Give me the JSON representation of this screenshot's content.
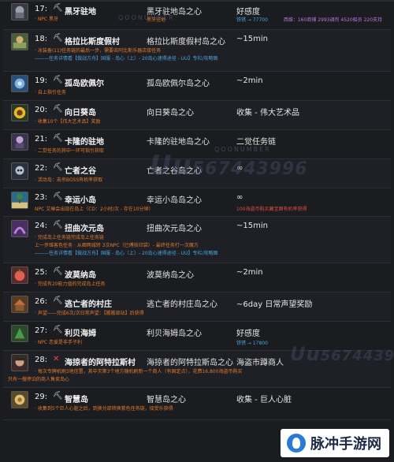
{
  "rows": [
    {
      "num": "17:",
      "title": "黑牙驻地",
      "location": "黑牙驻地岛之心",
      "reward": "好感度",
      "subs": [
        {
          "text": "· NPC 黑牙",
          "color": "orange"
        }
      ],
      "loc_extra": "黑牙驻地",
      "fav_values": {
        "blue": "铁锈 → 77700",
        "purple": "西维：160商铺 2993调剂 4520船员 220支持"
      }
    },
    {
      "num": "18:",
      "title": "格拉比斯度假村",
      "location": "格拉比斯度假村岛之心",
      "reward": "~15min",
      "subs": [
        {
          "text": "· 冰装备(11)任务链的最后一步，需要去阿比斯乐器店接任务",
          "color": "orange"
        },
        {
          "text": "———任务详情看【做战方舟】国服 - 岛心（上）- 20岛心速得途径 - UU】专栏/攻略图",
          "color": "blue"
        }
      ]
    },
    {
      "num": "19:",
      "title": "孤岛欧佩尔",
      "location": "孤岛欧佩尔岛之心",
      "reward": "~2min",
      "subs": [
        {
          "text": "· 自上指引任务",
          "color": "orange"
        }
      ]
    },
    {
      "num": "20:",
      "title": "向日葵岛",
      "location": "向日葵岛之心",
      "reward": "收集 - 伟大艺术品",
      "subs": [
        {
          "text": "· 收集10个【伟大艺术品】奖励",
          "color": "orange"
        }
      ]
    },
    {
      "num": "21:",
      "title": "卡隆的驻地",
      "location": "卡隆的驻地岛之心",
      "reward": "二觉任务链",
      "subs": [
        {
          "text": "· 二觉任务的其中一环可指引获取",
          "color": "orange"
        }
      ]
    },
    {
      "num": "22:",
      "title": "亡者之谷",
      "location": "亡者之谷岛之心",
      "reward": "∞",
      "subs": [
        {
          "text": "· 活动岛：击杀BOSS有机率获取",
          "color": "orange"
        }
      ]
    },
    {
      "num": "23:",
      "title": "幸运小岛",
      "location": "幸运小岛岛之心",
      "reward": "∞",
      "subs": [
        {
          "text": "NPC 艾琳会出现在岛上（CD：2小时/次 - 存在10分钟）",
          "color": "orange"
        },
        {
          "text": "100海盗币购买藏宝图有机率获得",
          "color": "red",
          "col": "right"
        }
      ]
    },
    {
      "num": "24:",
      "title": "扭曲次元岛",
      "location": "扭曲次元岛之心",
      "reward": "~15min",
      "subs": [
        {
          "text": "· 完成岛上任务链完成岛上任务链",
          "color": "orange"
        },
        {
          "text": "上一步维客色任务 · 从卿两城转 3次NPC（已傅技印袋）- 最终任务打一次魔方",
          "color": "orange"
        },
        {
          "text": "———任务详情看【做战方舟】国服 - 岛心（上）- 20岛心速得途径 - UU】专栏/攻略图",
          "color": "blue"
        }
      ]
    },
    {
      "num": "25:",
      "title": "波莫纳岛",
      "location": "波莫纳岛之心",
      "reward": "~2min",
      "subs": [
        {
          "text": "· 完成有20能力值的完成岛上任务",
          "color": "orange"
        }
      ]
    },
    {
      "num": "26:",
      "title": "逃亡者的村庄",
      "location": "逃亡者的村庄岛之心",
      "reward": "~6day 日常声望奖励",
      "subs": [
        {
          "text": "· 声望——完成6次/次日常声望：【搬搬部站】后获得",
          "color": "orange"
        }
      ]
    },
    {
      "num": "27:",
      "title": "利贝海姆",
      "location": "利贝海姆岛之心",
      "reward": "好感度",
      "subs": [
        {
          "text": "· NPC 恋爱是非手子利",
          "color": "orange"
        }
      ],
      "fav_values": {
        "blue": "铁锈 → 17800"
      }
    },
    {
      "num": "28:",
      "title": "海掠者的阿特拉斯村",
      "location": "海掠者的阿特拉斯岛之心",
      "reward": "海盗市蹲商人",
      "subs": [
        {
          "text": "· 每次专牌机刷3地信置，其中灭第3个地方随机刷新一个商人（有固定点），花费16,800海盗币购买",
          "color": "orange"
        },
        {
          "text": "只有一艘停泊的商人售卖岛心",
          "color": "orange",
          "indent": "left"
        }
      ]
    },
    {
      "num": "29:",
      "title": "智慧岛",
      "location": "智慧岛之心",
      "reward": "收集 - 巨人心脏",
      "subs": [
        {
          "text": "· 收集到5个巨人心脏之后，到换兑部转换紫色任务链，接受乐获得",
          "color": "orange"
        }
      ]
    }
  ],
  "watermark": {
    "main": "Uu",
    "code": "567443996",
    "sub": "QOONUMBER"
  },
  "brand": {
    "text": "脉冲手游网"
  }
}
